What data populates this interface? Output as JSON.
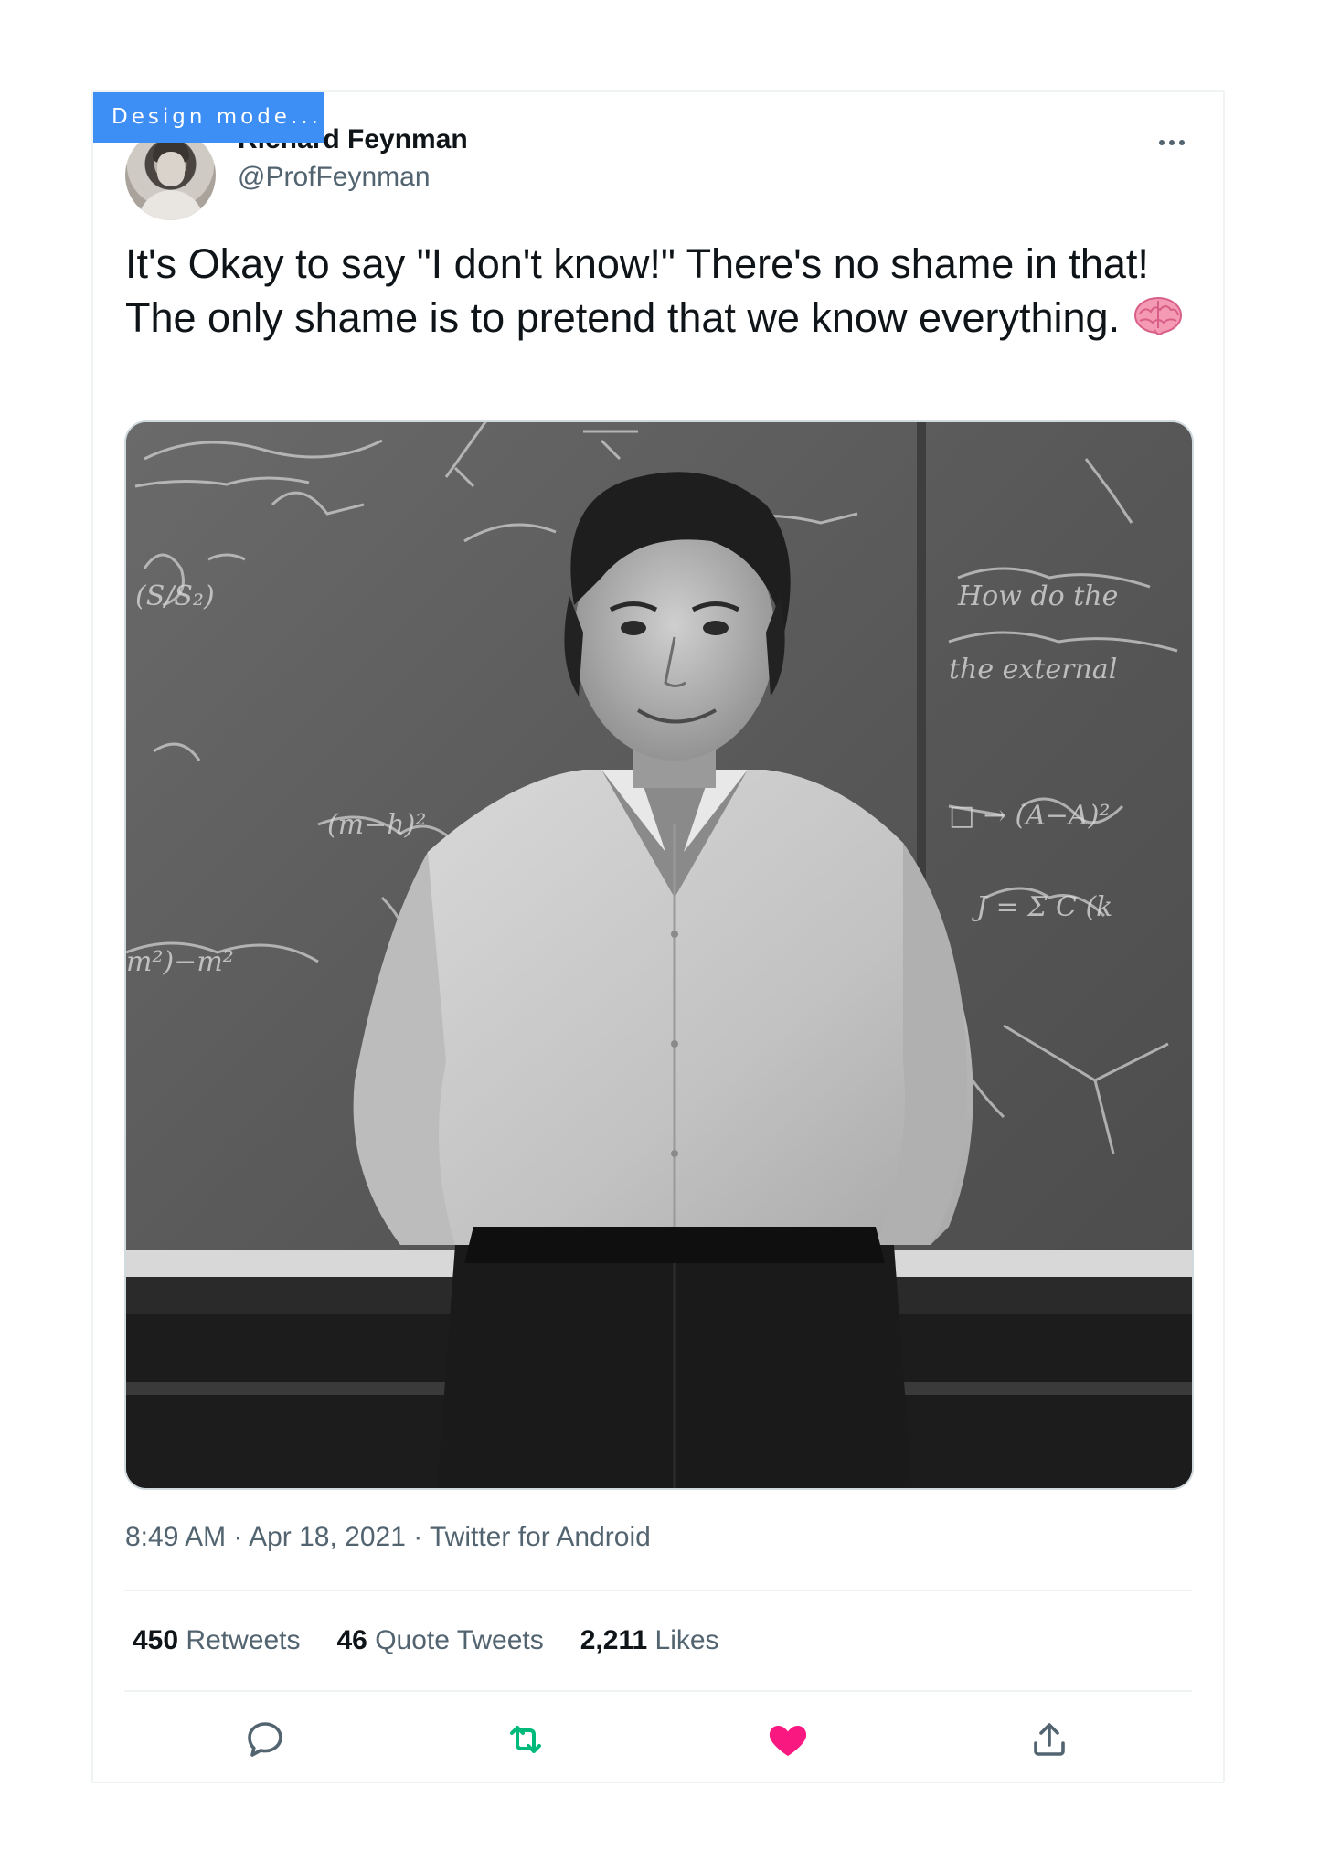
{
  "badge": {
    "label": "Design mode..."
  },
  "tweet": {
    "author": {
      "display_name": "Richard Feynman",
      "handle": "@ProfFeynman"
    },
    "text": "It's Okay to say \"I don't know!\" There's no shame in that! The only shame is to pretend that we know everything.",
    "emoji_icon": "brain-emoji-icon",
    "meta": {
      "time": "8:49 AM",
      "date": "Apr 18, 2021",
      "client": "Twitter for Android",
      "separator": " · "
    },
    "stats": {
      "retweets_count": "450",
      "retweets_label": "Retweets",
      "quotes_count": "46",
      "quotes_label": "Quote Tweets",
      "likes_count": "2,211",
      "likes_label": "Likes"
    },
    "actions": {
      "reply_icon": "reply-icon",
      "retweet_icon": "retweet-icon",
      "like_icon": "heart-icon",
      "share_icon": "share-icon"
    }
  },
  "colors": {
    "badge": "#3d8ef5",
    "text_primary": "#0f1419",
    "text_secondary": "#536471",
    "retweet_active": "#00ba7c",
    "like_active": "#f91880",
    "divider": "#eff3f4"
  }
}
